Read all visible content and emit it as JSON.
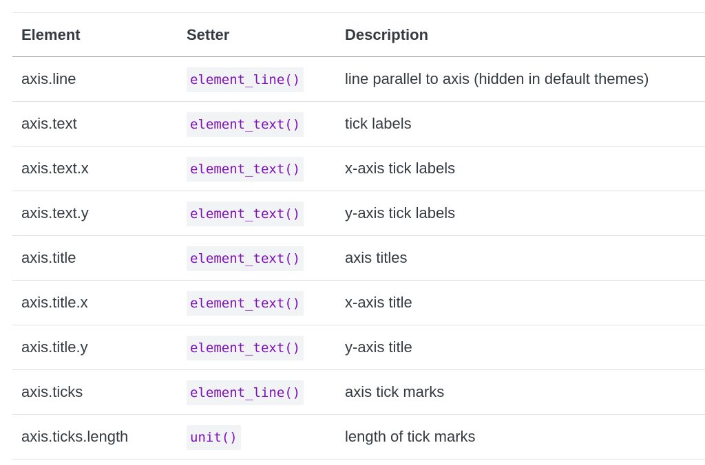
{
  "table": {
    "headers": [
      "Element",
      "Setter",
      "Description"
    ],
    "rows": [
      {
        "element": "axis.line",
        "setter": "element_line()",
        "description": "line parallel to axis (hidden in default themes)"
      },
      {
        "element": "axis.text",
        "setter": "element_text()",
        "description": "tick labels"
      },
      {
        "element": "axis.text.x",
        "setter": "element_text()",
        "description": "x-axis tick labels"
      },
      {
        "element": "axis.text.y",
        "setter": "element_text()",
        "description": "y-axis tick labels"
      },
      {
        "element": "axis.title",
        "setter": "element_text()",
        "description": "axis titles"
      },
      {
        "element": "axis.title.x",
        "setter": "element_text()",
        "description": "x-axis title"
      },
      {
        "element": "axis.title.y",
        "setter": "element_text()",
        "description": "y-axis title"
      },
      {
        "element": "axis.ticks",
        "setter": "element_line()",
        "description": "axis tick marks"
      },
      {
        "element": "axis.ticks.length",
        "setter": "unit()",
        "description": "length of tick marks"
      }
    ]
  }
}
